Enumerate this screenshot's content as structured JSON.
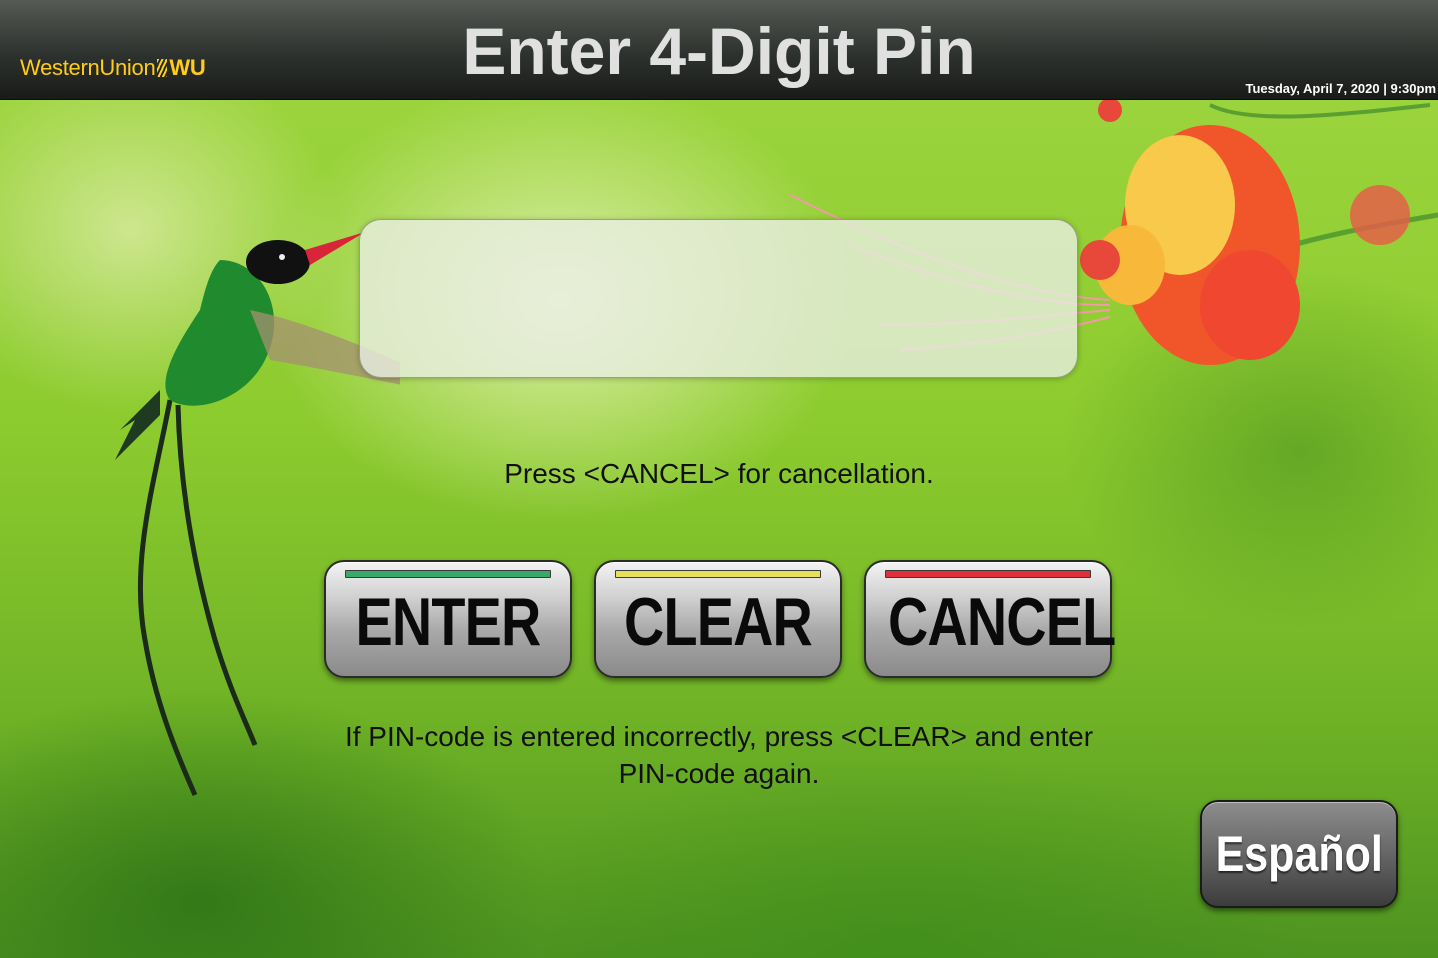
{
  "header": {
    "logo_text": "WesternUnion",
    "logo_abbr": "WU",
    "title": "Enter 4-Digit Pin",
    "datetime": "Tuesday, April 7, 2020 | 9:30pm"
  },
  "pin_input": {
    "value": "",
    "max_digits": 4
  },
  "instructions": {
    "cancel_hint": "Press <CANCEL> for cancellation.",
    "clear_hint": "If PIN-code is entered incorrectly, press <CLEAR> and enter PIN-code again."
  },
  "keys": {
    "enter": {
      "label": "ENTER",
      "stripe_color": "#3aa86a"
    },
    "clear": {
      "label": "CLEAR",
      "stripe_color": "#e8e05a"
    },
    "cancel": {
      "label": "CANCEL",
      "stripe_color": "#e0303a"
    }
  },
  "language_button": {
    "label": "Español"
  },
  "colors": {
    "brand_yellow": "#ffcc1a",
    "title_text": "#dfe0df"
  },
  "background": {
    "hummingbird_icon": "hummingbird-illustration",
    "flower_icon": "flower-illustration"
  }
}
